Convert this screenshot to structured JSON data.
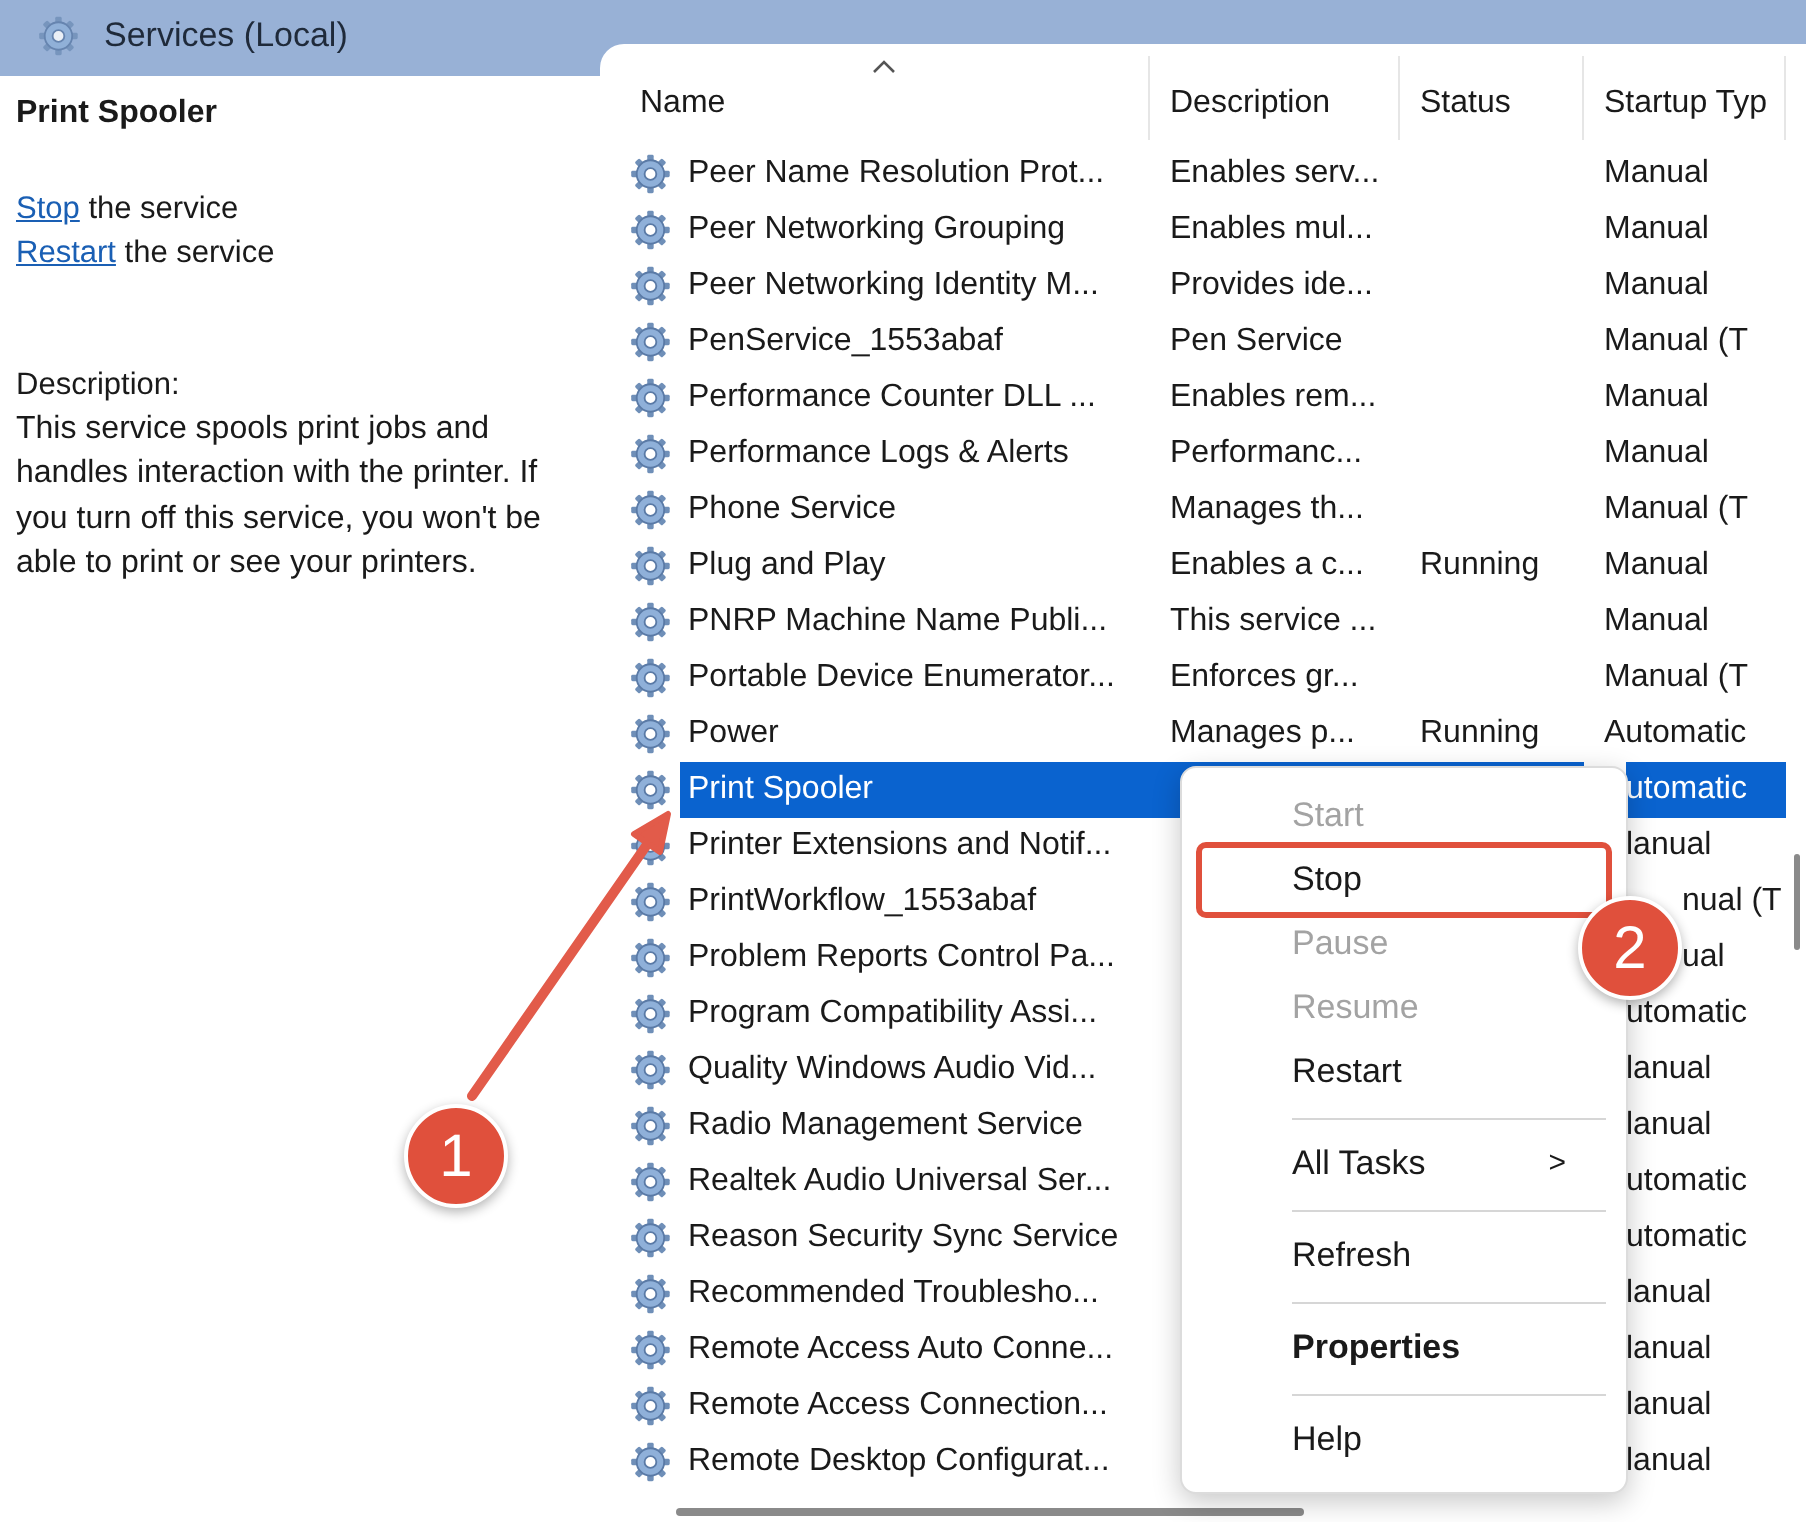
{
  "window": {
    "title": "Services (Local)"
  },
  "details": {
    "heading": "Print Spooler",
    "actions": [
      {
        "link": "Stop",
        "text": " the service"
      },
      {
        "link": "Restart",
        "text": " the service"
      }
    ],
    "description_label": "Description:",
    "description": "This service spools print jobs and handles interaction with the printer. If you turn off this service, you won't be able to print or see your printers."
  },
  "table": {
    "columns": [
      {
        "label": "Name",
        "sorted": true
      },
      {
        "label": "Description",
        "sorted": false
      },
      {
        "label": "Status",
        "sorted": false
      },
      {
        "label": "Startup Typ",
        "sorted": false
      }
    ],
    "rows": [
      {
        "name": "Peer Name Resolution Prot...",
        "description": "Enables serv...",
        "startup": "Manual",
        "selected": false
      },
      {
        "name": "Peer Networking Grouping",
        "description": "Enables mul...",
        "startup": "Manual",
        "selected": false
      },
      {
        "name": "Peer Networking Identity M...",
        "description": "Provides ide...",
        "startup": "Manual",
        "selected": false
      },
      {
        "name": "PenService_1553abaf",
        "description": "Pen Service",
        "startup": "Manual (T",
        "selected": false
      },
      {
        "name": "Performance Counter DLL ...",
        "description": "Enables rem...",
        "startup": "Manual",
        "selected": false
      },
      {
        "name": "Performance Logs & Alerts",
        "description": "Performanc...",
        "startup": "Manual",
        "selected": false
      },
      {
        "name": "Phone Service",
        "description": "Manages th...",
        "startup": "Manual (T",
        "selected": false
      },
      {
        "name": "Plug and Play",
        "description": "Enables a c...",
        "status": "Running",
        "startup": "Manual",
        "selected": false
      },
      {
        "name": "PNRP Machine Name Publi...",
        "description": "This service ...",
        "startup": "Manual",
        "selected": false
      },
      {
        "name": "Portable Device Enumerator...",
        "description": "Enforces gr...",
        "startup": "Manual (T",
        "selected": false
      },
      {
        "name": "Power",
        "description": "Manages p...",
        "status": "Running",
        "startup": "Automatic",
        "selected": false
      },
      {
        "name": "Print Spooler",
        "startup": "utomatic",
        "selected": true
      },
      {
        "name": "Printer Extensions and Notif...",
        "startup": "lanual",
        "selected": false
      },
      {
        "name": "PrintWorkflow_1553abaf",
        "startup": "nual (T",
        "selected": false
      },
      {
        "name": "Problem Reports Control Pa...",
        "startup": "ual",
        "selected": false
      },
      {
        "name": "Program Compatibility Assi...",
        "startup": "utomatic",
        "selected": false
      },
      {
        "name": "Quality Windows Audio Vid...",
        "startup": "lanual",
        "selected": false
      },
      {
        "name": "Radio Management Service",
        "startup": "lanual",
        "selected": false
      },
      {
        "name": "Realtek Audio Universal Ser...",
        "startup": "utomatic",
        "selected": false
      },
      {
        "name": "Reason Security Sync Service",
        "startup": "utomatic",
        "selected": false
      },
      {
        "name": "Recommended Troublesho...",
        "startup": "lanual",
        "selected": false
      },
      {
        "name": "Remote Access Auto Conne...",
        "startup": "lanual",
        "selected": false
      },
      {
        "name": "Remote Access Connection...",
        "startup": "lanual",
        "selected": false
      },
      {
        "name": "Remote Desktop Configurat...",
        "startup": "lanual",
        "selected": false
      }
    ]
  },
  "context_menu": {
    "items": [
      {
        "kind": "item",
        "label": "Start",
        "disabled": true,
        "default": false,
        "highlighted": false
      },
      {
        "kind": "item",
        "label": "Stop",
        "disabled": false,
        "default": false,
        "highlighted": true
      },
      {
        "kind": "item",
        "label": "Pause",
        "disabled": true,
        "default": false,
        "highlighted": false
      },
      {
        "kind": "item",
        "label": "Resume",
        "disabled": true,
        "default": false,
        "highlighted": false
      },
      {
        "kind": "item",
        "label": "Restart",
        "disabled": false,
        "default": false,
        "highlighted": false
      },
      {
        "kind": "separator"
      },
      {
        "kind": "item",
        "label": "All Tasks",
        "arrow": ">",
        "disabled": false,
        "default": false,
        "highlighted": false
      },
      {
        "kind": "separator"
      },
      {
        "kind": "item",
        "label": "Refresh",
        "disabled": false,
        "default": false,
        "highlighted": false
      },
      {
        "kind": "separator"
      },
      {
        "kind": "item",
        "label": "Properties",
        "disabled": false,
        "default": true,
        "highlighted": false
      },
      {
        "kind": "separator"
      },
      {
        "kind": "item",
        "label": "Help",
        "disabled": false,
        "default": false,
        "highlighted": false
      }
    ]
  },
  "annotations": [
    {
      "label": "1"
    },
    {
      "label": "2"
    }
  ]
}
